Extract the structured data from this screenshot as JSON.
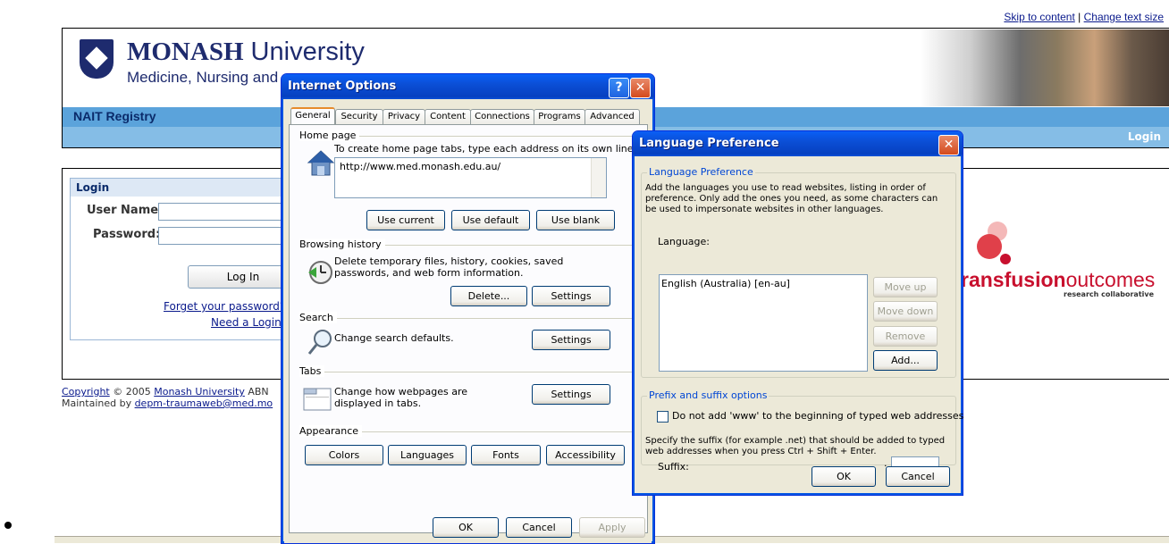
{
  "page": {
    "skip_link": "Skip to content",
    "separator": "|",
    "change_text_link": "Change text size",
    "university_bold": "MONASH",
    "university_rest": " University",
    "faculty_visible": "Medicine, Nursing and",
    "registry_title": "NAIT Registry",
    "login_link": "Login",
    "login_panel": {
      "title": "Login",
      "username_label": "User Name:",
      "password_label": "Password:",
      "login_button": "Log In",
      "forgot_link": "Forget your password?",
      "need_login_link": "Need a Login?"
    },
    "logo": {
      "prefix": "ransfusion",
      "suffix": "outcomes",
      "tagline": "research collaborative"
    },
    "footer": {
      "copyright_word": "Copyright",
      "copyright_rest": " © 2005 ",
      "university_link": "Monash University",
      "abn": " ABN",
      "maintained_by": "Maintained by ",
      "email_link": "depm-traumaweb@med.mo"
    }
  },
  "internet_options": {
    "title": "Internet Options",
    "help_button": "?",
    "close_button": "✕",
    "tabs": [
      "General",
      "Security",
      "Privacy",
      "Content",
      "Connections",
      "Programs",
      "Advanced"
    ],
    "home_page": {
      "group": "Home page",
      "description": "To create home page tabs, type each address on its own line.",
      "url": "http://www.med.monash.edu.au/",
      "use_current": "Use current",
      "use_default": "Use default",
      "use_blank": "Use blank"
    },
    "browsing_history": {
      "group": "Browsing history",
      "description": "Delete temporary files, history, cookies, saved passwords, and web form information.",
      "delete": "Delete...",
      "settings": "Settings"
    },
    "search": {
      "group": "Search",
      "description": "Change search defaults.",
      "settings": "Settings"
    },
    "tabs_group": {
      "group": "Tabs",
      "description": "Change how webpages are displayed in tabs.",
      "settings": "Settings"
    },
    "appearance": {
      "group": "Appearance",
      "colors": "Colors",
      "languages": "Languages",
      "fonts": "Fonts",
      "accessibility": "Accessibility"
    },
    "ok": "OK",
    "cancel": "Cancel",
    "apply": "Apply"
  },
  "language_preference": {
    "title": "Language Preference",
    "close_button": "✕",
    "group": "Language Preference",
    "description": "Add the languages you use to read websites, listing in order of preference. Only add the ones you need, as some characters can be used to impersonate websites in other languages.",
    "language_label": "Language:",
    "languages": [
      "English (Australia) [en-au]"
    ],
    "move_up": "Move up",
    "move_down": "Move down",
    "remove": "Remove",
    "add": "Add...",
    "prefix_group": "Prefix and suffix options",
    "checkbox_label": "Do not add 'www' to the beginning of typed web addresses",
    "checkbox_checked": false,
    "suffix_description": "Specify the suffix (for example .net) that should be added to typed web addresses when you press Ctrl + Shift + Enter.",
    "suffix_label": "Suffix:",
    "suffix_dot": ".",
    "suffix_value": "",
    "ok": "OK",
    "cancel": "Cancel"
  },
  "colors": {
    "xp_blue": "#0054e3",
    "nav_blue": "#5ba3db",
    "brand_navy": "#1e2b6e",
    "logo_red": "#c8102e"
  }
}
